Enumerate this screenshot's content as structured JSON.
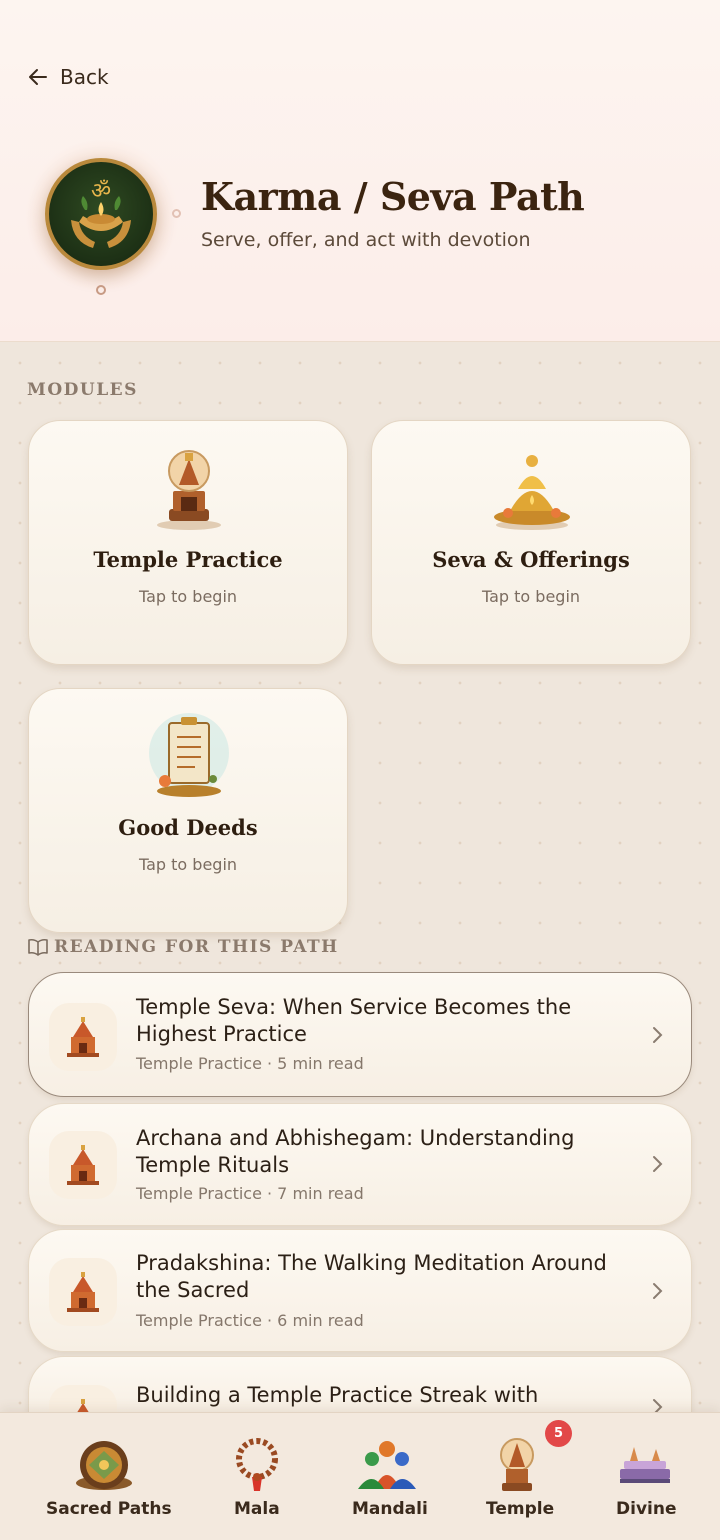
{
  "header": {
    "back_label": "Back",
    "title": "Karma / Seva Path",
    "subtitle": "Serve, offer, and act with devotion"
  },
  "modules": {
    "label": "MODULES",
    "items": [
      {
        "title": "Temple Practice",
        "subtitle": "Tap to begin",
        "icon": "temple-lamp-icon"
      },
      {
        "title": "Seva & Offerings",
        "subtitle": "Tap to begin",
        "icon": "offering-pot-icon"
      },
      {
        "title": "Good Deeds",
        "subtitle": "Tap to begin",
        "icon": "checklist-icon"
      }
    ]
  },
  "reading": {
    "label": "READING FOR THIS PATH",
    "articles": [
      {
        "title_line1": "Temple Seva: When Service Becomes the",
        "title_line2": "Highest Practice",
        "meta": "Temple Practice · 5 min read"
      },
      {
        "title_line1": "Archana and Abhishegam: Understanding",
        "title_line2": "Temple Rituals",
        "meta": "Temple Practice · 7 min read"
      },
      {
        "title_line1": "Pradakshina: The Walking Meditation Around",
        "title_line2": "the Sacred",
        "meta": "Temple Practice · 6 min read"
      },
      {
        "title_line1": "Building a Temple Practice Streak with Sankalpa",
        "title_line2": "",
        "meta": ""
      }
    ]
  },
  "nav": {
    "items": [
      {
        "label": "Sacred Paths",
        "icon": "sacred-paths-icon"
      },
      {
        "label": "Mala",
        "icon": "mala-beads-icon"
      },
      {
        "label": "Mandali",
        "icon": "mandali-group-icon"
      },
      {
        "label": "Temple",
        "icon": "temple-icon",
        "badge": "5"
      },
      {
        "label": "Divine",
        "icon": "divine-icon"
      }
    ]
  },
  "colors": {
    "accent": "#b9893c",
    "badge": "#e24848",
    "text": "#3a2a1c"
  }
}
